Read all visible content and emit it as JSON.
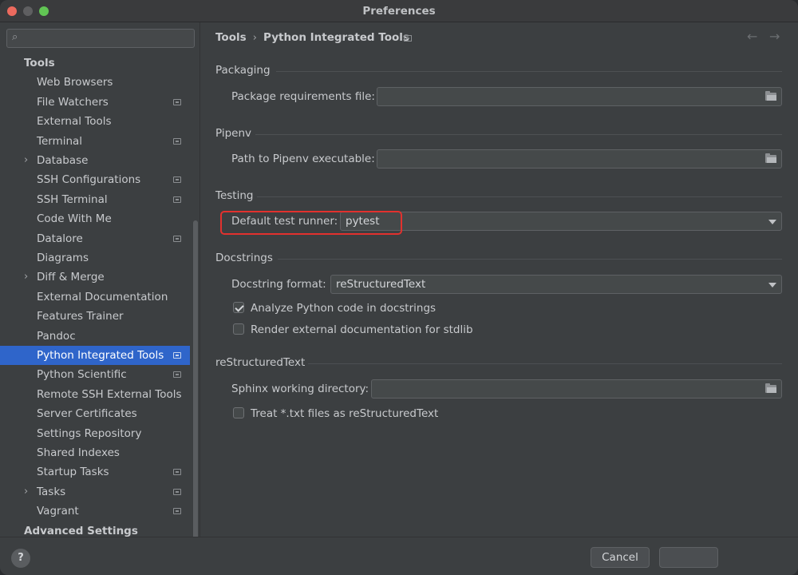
{
  "window": {
    "title": "Preferences"
  },
  "search": {
    "placeholder": ""
  },
  "sidebar": {
    "items": [
      {
        "label": "Tools",
        "type": "group"
      },
      {
        "label": "Web Browsers"
      },
      {
        "label": "File Watchers",
        "badge": true
      },
      {
        "label": "External Tools"
      },
      {
        "label": "Terminal",
        "badge": true
      },
      {
        "label": "Database",
        "expandable": true
      },
      {
        "label": "SSH Configurations",
        "badge": true
      },
      {
        "label": "SSH Terminal",
        "badge": true
      },
      {
        "label": "Code With Me"
      },
      {
        "label": "Datalore",
        "badge": true
      },
      {
        "label": "Diagrams"
      },
      {
        "label": "Diff & Merge",
        "expandable": true
      },
      {
        "label": "External Documentation"
      },
      {
        "label": "Features Trainer"
      },
      {
        "label": "Pandoc"
      },
      {
        "label": "Python Integrated Tools",
        "badge": true,
        "selected": true
      },
      {
        "label": "Python Scientific",
        "badge": true
      },
      {
        "label": "Remote SSH External Tools"
      },
      {
        "label": "Server Certificates"
      },
      {
        "label": "Settings Repository"
      },
      {
        "label": "Shared Indexes"
      },
      {
        "label": "Startup Tasks",
        "badge": true
      },
      {
        "label": "Tasks",
        "expandable": true,
        "badge": true
      },
      {
        "label": "Vagrant",
        "badge": true
      },
      {
        "label": "Advanced Settings",
        "type": "group"
      }
    ]
  },
  "header": {
    "crumb_parent": "Tools",
    "crumb_sep": "›",
    "crumb_current": "Python Integrated Tools"
  },
  "sections": {
    "packaging": {
      "title": "Packaging",
      "label": "Package requirements file:",
      "value": ""
    },
    "pipenv": {
      "title": "Pipenv",
      "label": "Path to Pipenv executable:",
      "value": ""
    },
    "testing": {
      "title": "Testing",
      "label": "Default test runner:",
      "value": "pytest"
    },
    "docstrings": {
      "title": "Docstrings",
      "label": "Docstring format:",
      "value": "reStructuredText",
      "analyze_label": "Analyze Python code in docstrings",
      "analyze_checked": true,
      "render_label": "Render external documentation for stdlib",
      "render_checked": false
    },
    "rst": {
      "title": "reStructuredText",
      "label": "Sphinx working directory:",
      "value": "",
      "treat_label": "Treat *.txt files as reStructuredText",
      "treat_checked": false
    }
  },
  "footer": {
    "help": "?",
    "cancel": "Cancel"
  },
  "colors": {
    "accent": "#2f65ca",
    "highlight": "#e2312e"
  }
}
